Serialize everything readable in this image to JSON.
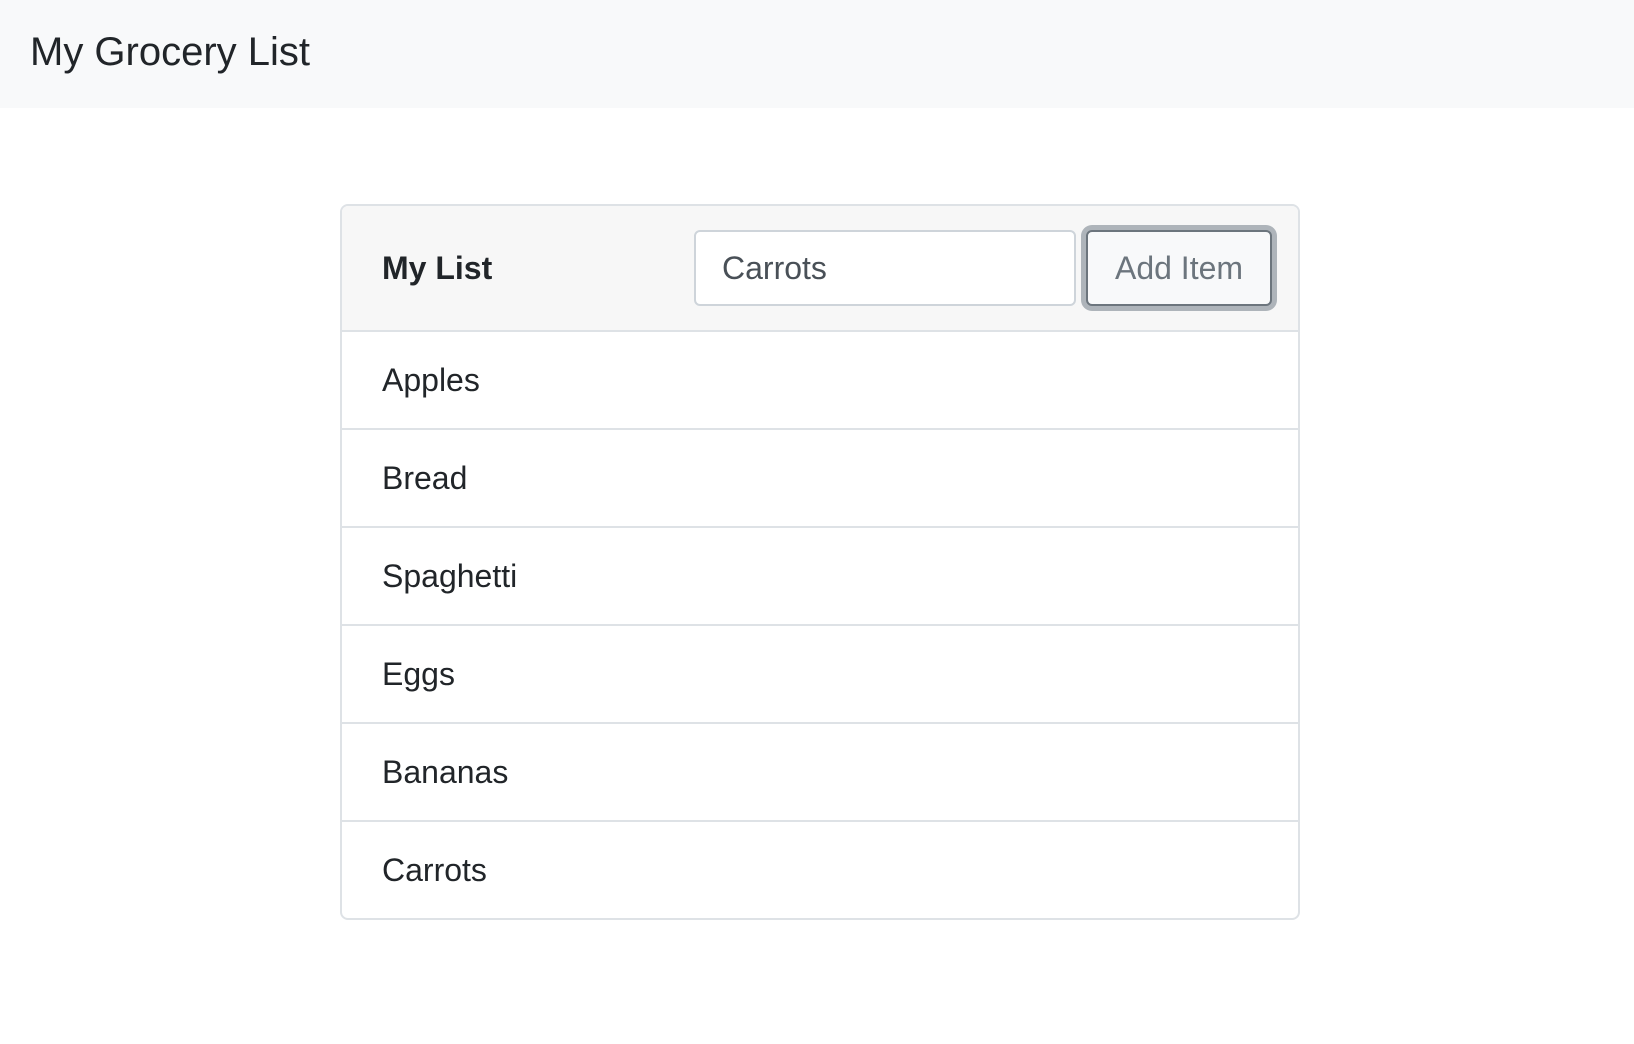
{
  "navbar": {
    "brand": "My Grocery List"
  },
  "card": {
    "title": "My List",
    "input": {
      "value": "Carrots",
      "placeholder": ""
    },
    "add_button_label": "Add Item",
    "items": [
      {
        "label": "Apples"
      },
      {
        "label": "Bread"
      },
      {
        "label": "Spaghetti"
      },
      {
        "label": "Eggs"
      },
      {
        "label": "Bananas"
      },
      {
        "label": "Carrots"
      }
    ]
  },
  "colors": {
    "navbar_bg": "#f8f9fa",
    "card_header_bg": "#f7f7f7",
    "border": "#dee2e6",
    "button_text": "#6c757d"
  }
}
